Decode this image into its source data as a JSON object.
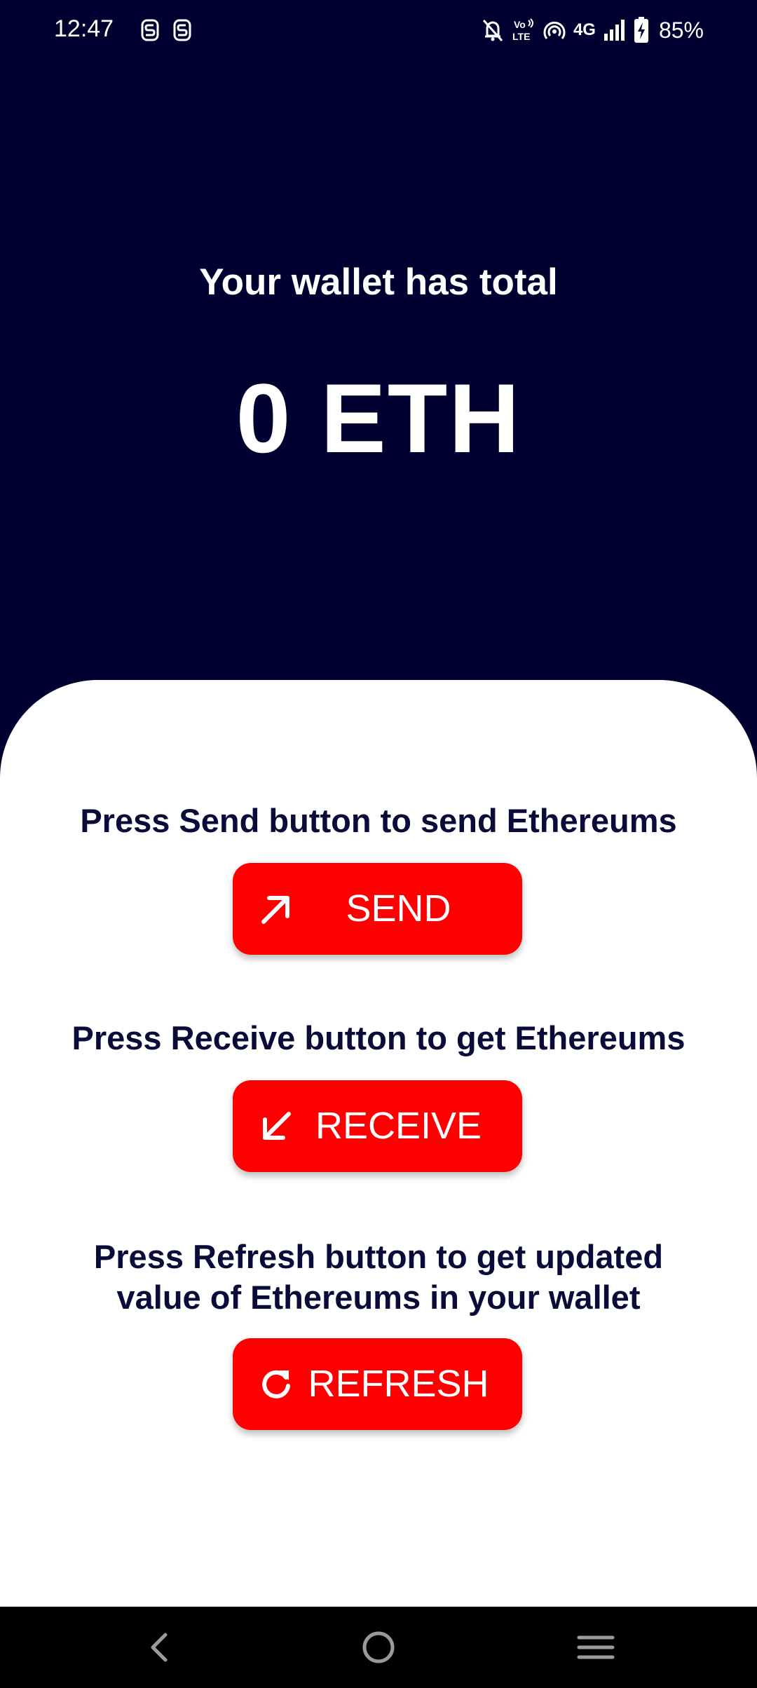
{
  "status_bar": {
    "time": "12:47",
    "network": "4G",
    "volte": "Vo LTE",
    "battery_percent": "85%",
    "icons": [
      "sim-s-icon",
      "sim-s-icon",
      "bell-off-icon",
      "volte-icon",
      "hotspot-icon",
      "signal-icon",
      "battery-charging-icon"
    ]
  },
  "wallet": {
    "caption": "Your wallet has total",
    "balance": "0 ETH"
  },
  "actions": {
    "send": {
      "instruction": "Press Send button to send Ethereums",
      "label": "SEND",
      "icon": "arrow-up-right-icon"
    },
    "receive": {
      "instruction": "Press Receive button to get Ethereums",
      "label": "RECEIVE",
      "icon": "arrow-down-left-icon"
    },
    "refresh": {
      "instruction_line1": "Press Refresh button to get updated",
      "instruction_line2": "value of Ethereums in your wallet",
      "label": "REFRESH",
      "icon": "refresh-icon"
    }
  },
  "nav_bar": {
    "icons": [
      "back-icon",
      "home-icon",
      "recents-icon"
    ]
  },
  "colors": {
    "header_bg": "#000030",
    "accent": "#ff0000",
    "text_dark": "#0b0b3a",
    "card_bg": "#ffffff"
  }
}
